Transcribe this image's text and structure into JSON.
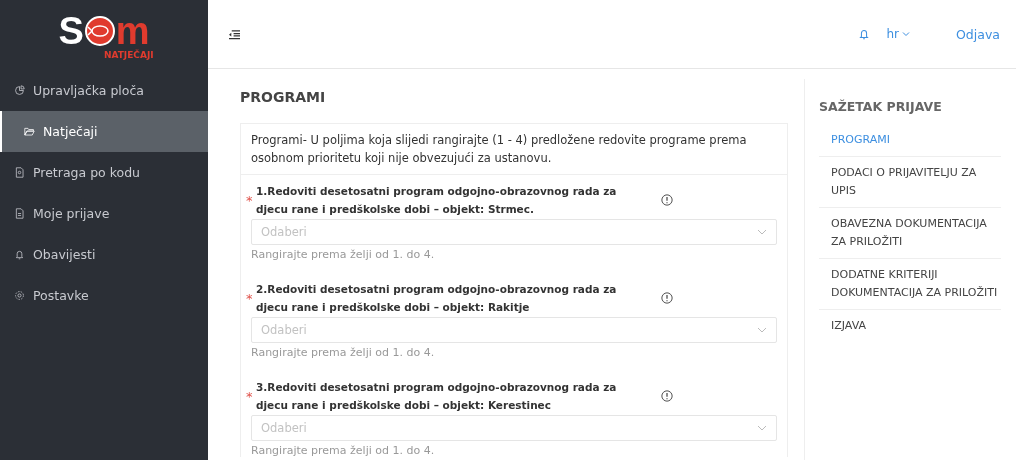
{
  "logo": {
    "left": "S",
    "right": "m",
    "subtitle": "NATJEČAJI"
  },
  "sidebar": {
    "items": [
      {
        "label": "Upravljačka ploča",
        "selected": false
      },
      {
        "label": "Natječaji",
        "selected": true
      },
      {
        "label": "Pretraga po kodu",
        "selected": false
      },
      {
        "label": "Moje prijave",
        "selected": false
      },
      {
        "label": "Obavijesti",
        "selected": false
      },
      {
        "label": "Postavke",
        "selected": false
      }
    ]
  },
  "header": {
    "language": "hr",
    "logout": "Odjava"
  },
  "page_title": "PROGRAMI",
  "intro": "Programi- U poljima koja slijedi rangirajte (1 - 4) predložene redovite programe prema osobnom prioritetu koji nije obvezujući za ustanovu.",
  "fields": [
    {
      "label": "1.Redoviti desetosatni program odgojno-obrazovnog rada za djecu rane i predškolske dobi – objekt: Strmec.",
      "required_mark": "*",
      "placeholder": "Odaberi",
      "hint": "Rangirajte prema želji od 1. do 4."
    },
    {
      "label": "2.Redoviti desetosatni program odgojno-obrazovnog rada za djecu rane i predškolske dobi – objekt: Rakitje",
      "required_mark": "*",
      "placeholder": "Odaberi",
      "hint": "Rangirajte prema želji od 1. do 4."
    },
    {
      "label": "3.Redoviti desetosatni program odgojno-obrazovnog rada za djecu rane i predškolske dobi – objekt: Kerestinec",
      "required_mark": "*",
      "placeholder": "Odaberi",
      "hint": "Rangirajte prema želji od 1. do 4."
    }
  ],
  "summary": {
    "title": "SAŽETAK PRIJAVE",
    "items": [
      {
        "label": "PROGRAMI",
        "selected": true
      },
      {
        "label": "PODACI O PRIJAVITELJU ZA UPIS",
        "selected": false
      },
      {
        "label": "OBAVEZNA DOKUMENTACIJA ZA PRILOŽITI",
        "selected": false
      },
      {
        "label": "DODATNE KRITERIJI DOKUMENTACIJA ZA PRILOŽITI",
        "selected": false
      },
      {
        "label": "IZJAVA",
        "selected": false
      }
    ]
  }
}
